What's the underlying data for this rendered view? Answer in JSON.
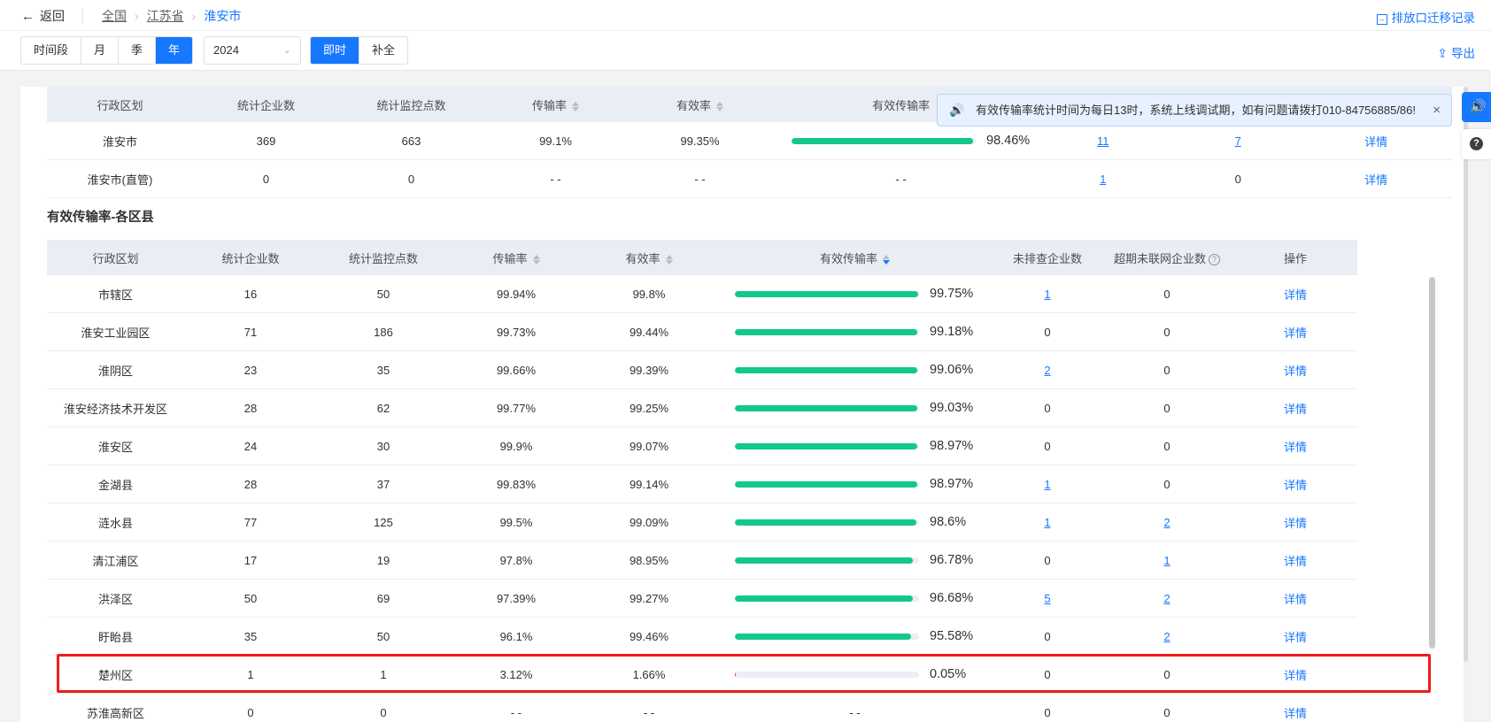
{
  "header": {
    "back_label": "返回",
    "breadcrumb": [
      "全国",
      "江苏省",
      "淮安市"
    ],
    "migrate_label": "排放口迁移记录"
  },
  "toolbar": {
    "period_tabs": [
      "时间段",
      "月",
      "季",
      "年"
    ],
    "period_active": "年",
    "year_value": "2024",
    "mode_tabs": [
      "即时",
      "补全"
    ],
    "mode_active": "即时",
    "export_label": "导出"
  },
  "notice": {
    "text": "有效传输率统计时间为每日13时，系统上线调试期，如有问题请拨打010-84756885/86!"
  },
  "city_table": {
    "headers": [
      "行政区划",
      "统计企业数",
      "统计监控点数",
      "传输率",
      "有效率",
      "有效传输率"
    ],
    "rows": [
      {
        "name": "淮安市",
        "companies": "369",
        "points": "663",
        "transmission": "99.1%",
        "validity": "99.35%",
        "effective": "98.46%",
        "effective_fraction": 0.9846,
        "unchecked": "11",
        "offline": "7",
        "action": "详情"
      },
      {
        "name": "淮安市(直管)",
        "companies": "0",
        "points": "0",
        "transmission": "- -",
        "validity": "- -",
        "effective": "- -",
        "effective_fraction": null,
        "unchecked": "1",
        "offline": "0",
        "action": "详情"
      }
    ]
  },
  "section_title": "有效传输率-各区县",
  "district_table": {
    "headers": [
      "行政区划",
      "统计企业数",
      "统计监控点数",
      "传输率",
      "有效率",
      "有效传输率",
      "未排查企业数",
      "超期未联网企业数",
      "操作"
    ],
    "rows": [
      {
        "name": "市辖区",
        "companies": "16",
        "points": "50",
        "transmission": "99.94%",
        "validity": "99.8%",
        "effective": "99.75%",
        "effective_fraction": 0.9975,
        "unchecked": "1",
        "offline": "0",
        "action": "详情"
      },
      {
        "name": "淮安工业园区",
        "companies": "71",
        "points": "186",
        "transmission": "99.73%",
        "validity": "99.44%",
        "effective": "99.18%",
        "effective_fraction": 0.9918,
        "unchecked": "0",
        "offline": "0",
        "action": "详情"
      },
      {
        "name": "淮阴区",
        "companies": "23",
        "points": "35",
        "transmission": "99.66%",
        "validity": "99.39%",
        "effective": "99.06%",
        "effective_fraction": 0.9906,
        "unchecked": "2",
        "offline": "0",
        "action": "详情"
      },
      {
        "name": "淮安经济技术开发区",
        "companies": "28",
        "points": "62",
        "transmission": "99.77%",
        "validity": "99.25%",
        "effective": "99.03%",
        "effective_fraction": 0.9903,
        "unchecked": "0",
        "offline": "0",
        "action": "详情"
      },
      {
        "name": "淮安区",
        "companies": "24",
        "points": "30",
        "transmission": "99.9%",
        "validity": "99.07%",
        "effective": "98.97%",
        "effective_fraction": 0.9897,
        "unchecked": "0",
        "offline": "0",
        "action": "详情"
      },
      {
        "name": "金湖县",
        "companies": "28",
        "points": "37",
        "transmission": "99.83%",
        "validity": "99.14%",
        "effective": "98.97%",
        "effective_fraction": 0.9897,
        "unchecked": "1",
        "offline": "0",
        "action": "详情"
      },
      {
        "name": "涟水县",
        "companies": "77",
        "points": "125",
        "transmission": "99.5%",
        "validity": "99.09%",
        "effective": "98.6%",
        "effective_fraction": 0.986,
        "unchecked": "1",
        "offline": "2",
        "action": "详情"
      },
      {
        "name": "清江浦区",
        "companies": "17",
        "points": "19",
        "transmission": "97.8%",
        "validity": "98.95%",
        "effective": "96.78%",
        "effective_fraction": 0.9678,
        "unchecked": "0",
        "offline": "1",
        "action": "详情"
      },
      {
        "name": "洪泽区",
        "companies": "50",
        "points": "69",
        "transmission": "97.39%",
        "validity": "99.27%",
        "effective": "96.68%",
        "effective_fraction": 0.9668,
        "unchecked": "5",
        "offline": "2",
        "action": "详情"
      },
      {
        "name": "盱眙县",
        "companies": "35",
        "points": "50",
        "transmission": "96.1%",
        "validity": "99.46%",
        "effective": "95.58%",
        "effective_fraction": 0.9558,
        "unchecked": "0",
        "offline": "2",
        "action": "详情"
      },
      {
        "name": "楚州区",
        "companies": "1",
        "points": "1",
        "transmission": "3.12%",
        "validity": "1.66%",
        "effective": "0.05%",
        "effective_fraction": 0.0005,
        "unchecked": "0",
        "offline": "0",
        "action": "详情"
      },
      {
        "name": "苏淮高新区",
        "companies": "0",
        "points": "0",
        "transmission": "- -",
        "validity": "- -",
        "effective": "- -",
        "effective_fraction": null,
        "unchecked": "0",
        "offline": "0",
        "action": "详情"
      }
    ]
  },
  "colors": {
    "accent": "#1677ff",
    "progress": "#13c78e",
    "highlight": "#ee1c1c"
  }
}
